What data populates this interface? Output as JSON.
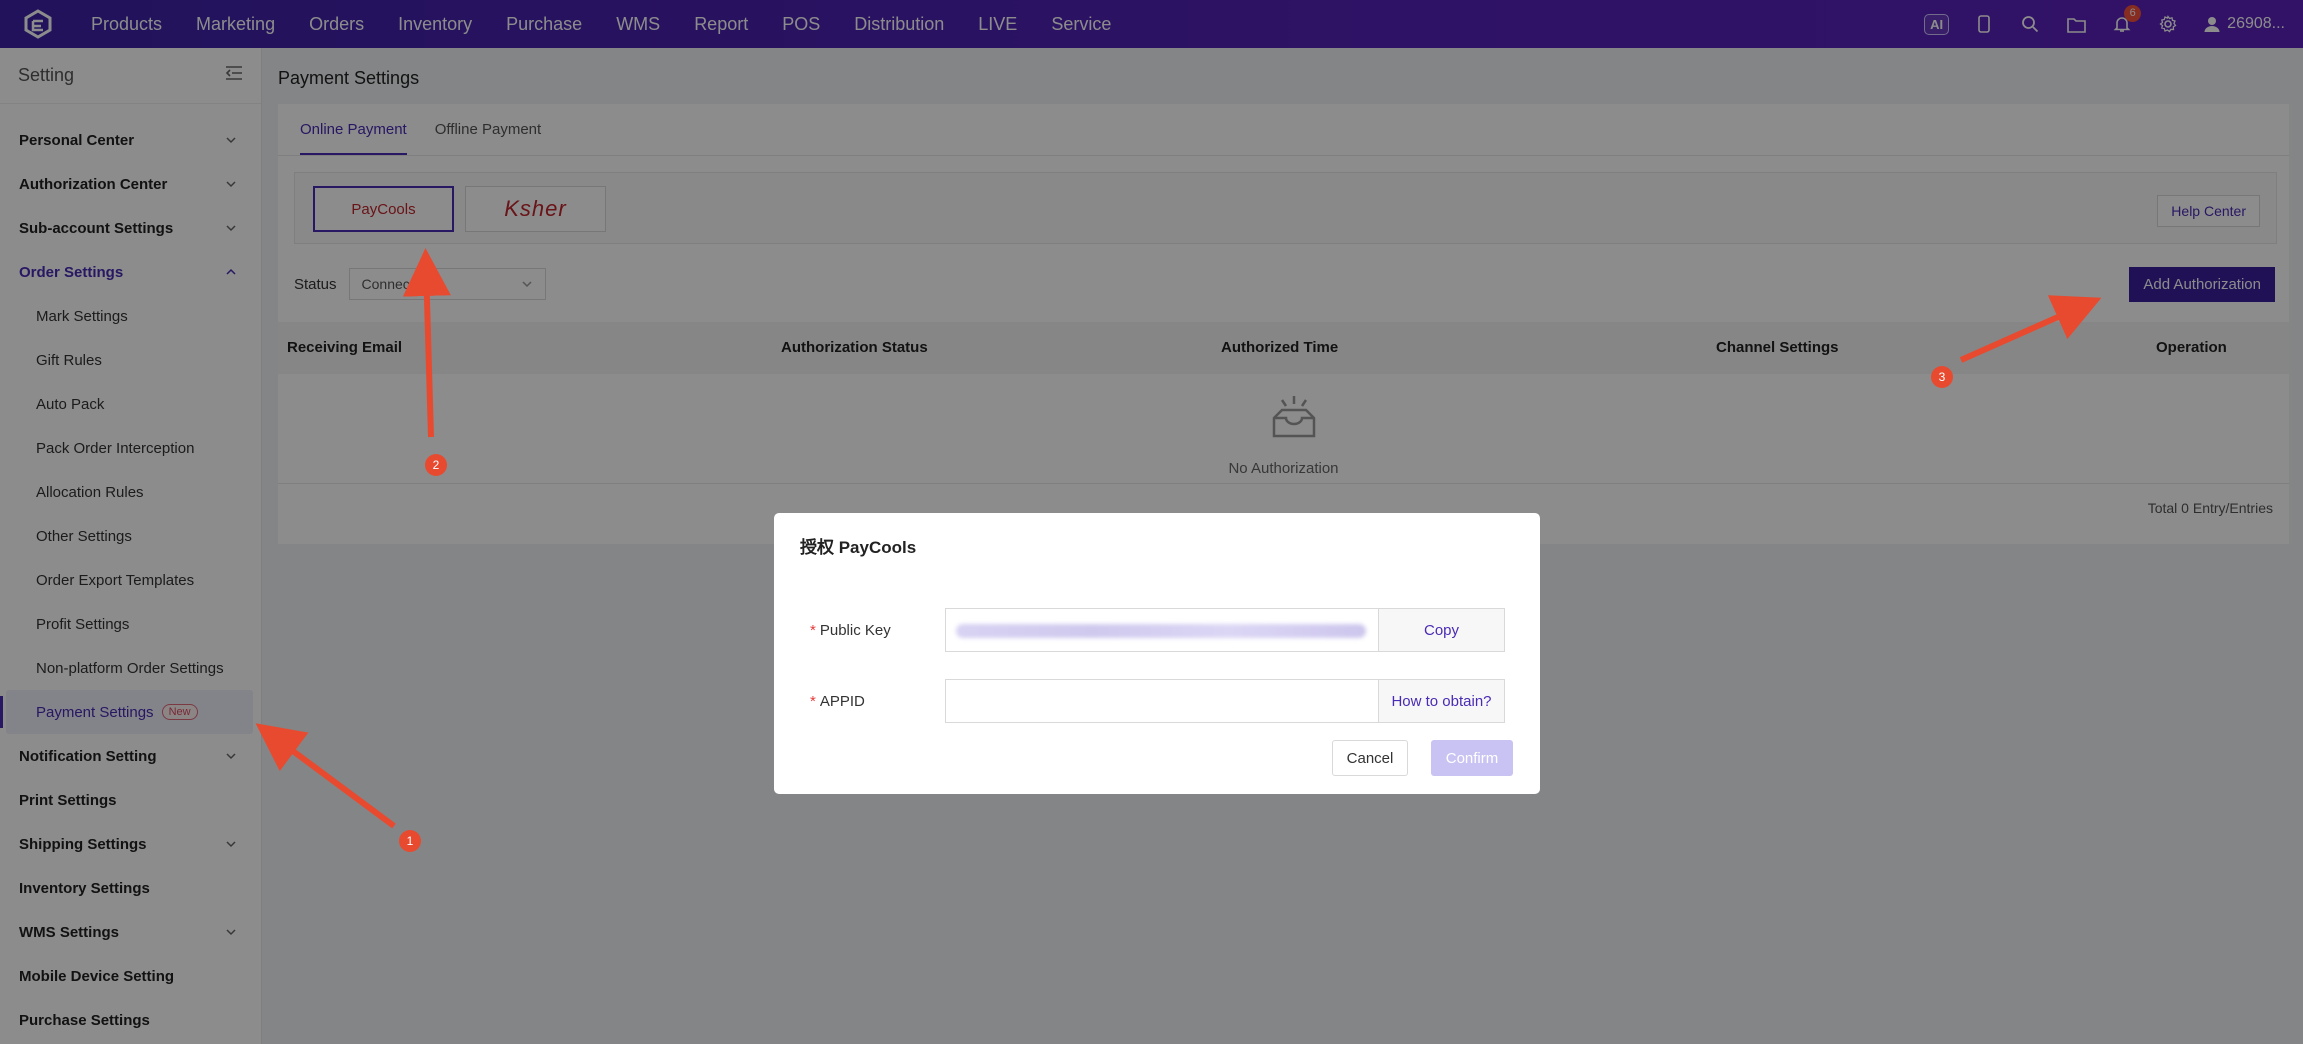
{
  "topnav": {
    "items": [
      "Products",
      "Marketing",
      "Orders",
      "Inventory",
      "Purchase",
      "WMS",
      "Report",
      "POS",
      "Distribution",
      "LIVE",
      "Service"
    ],
    "ai_label": "AI",
    "notification_count": "6",
    "user": "26908..."
  },
  "sidebar": {
    "title": "Setting",
    "groups": {
      "personal_center": "Personal Center",
      "authorization_center": "Authorization Center",
      "sub_account_settings": "Sub-account Settings",
      "order_settings": "Order Settings",
      "notification_setting": "Notification Setting",
      "print_settings": "Print Settings",
      "shipping_settings": "Shipping Settings",
      "inventory_settings": "Inventory Settings",
      "wms_settings": "WMS Settings",
      "mobile_device_setting": "Mobile Device Setting",
      "purchase_settings": "Purchase Settings"
    },
    "order_sub_items": [
      "Mark Settings",
      "Gift Rules",
      "Auto Pack",
      "Pack Order Interception",
      "Allocation Rules",
      "Other Settings",
      "Order Export Templates",
      "Profit Settings",
      "Non-platform Order Settings",
      "Payment Settings"
    ],
    "new_tag": "New"
  },
  "main": {
    "page_title": "Payment Settings",
    "tabs": [
      "Online Payment",
      "Offline Payment"
    ],
    "channels": [
      "PayCools",
      "Ksher"
    ],
    "help_center": "Help Center",
    "status_label": "Status",
    "status_value": "Connected",
    "add_authorization": "Add Authorization",
    "table_headers": [
      "Receiving Email",
      "Authorization Status",
      "Authorized Time",
      "Channel Settings",
      "Operation"
    ],
    "empty_text": "No Authorization",
    "total": "Total 0 Entry/Entries"
  },
  "modal": {
    "title": "授权 PayCools",
    "public_key_label": "Public Key",
    "copy": "Copy",
    "appid_label": "APPID",
    "how_to_obtain": "How to obtain?",
    "cancel": "Cancel",
    "confirm": "Confirm"
  },
  "annotations": [
    "1",
    "2",
    "3"
  ],
  "colors": {
    "accent": "#4a2bb5",
    "topbar": "#4a22b0",
    "annotation": "#e84a30"
  }
}
